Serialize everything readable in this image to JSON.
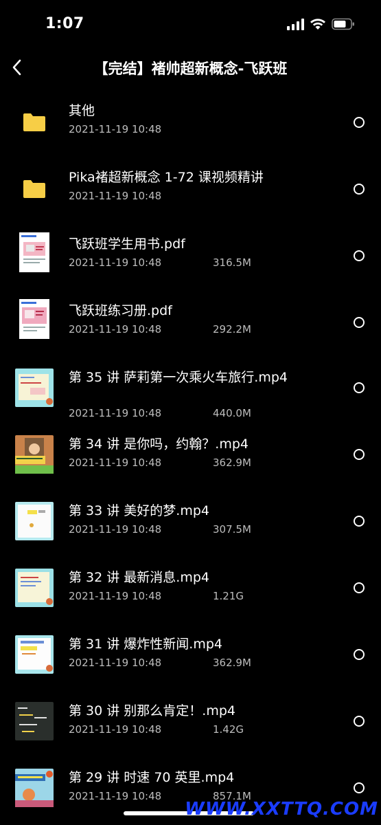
{
  "status_bar": {
    "time": "1:07"
  },
  "header": {
    "title": "【完结】褚帅超新概念-飞跃班",
    "back_icon": "chevron-left-icon"
  },
  "files": [
    {
      "name": "其他",
      "date": "2021-11-19 10:48",
      "size": "",
      "kind": "folder"
    },
    {
      "name": "Pika褚超新概念 1-72 课视频精讲",
      "date": "2021-11-19 10:48",
      "size": "",
      "kind": "folder"
    },
    {
      "name": "飞跃班学生用书.pdf",
      "date": "2021-11-19 10:48",
      "size": "316.5M",
      "kind": "pdf"
    },
    {
      "name": "飞跃班练习册.pdf",
      "date": "2021-11-19 10:48",
      "size": "292.2M",
      "kind": "pdf"
    },
    {
      "name": "第 35 讲 萨莉第一次乘火车旅行.mp4",
      "date": "2021-11-19 10:48",
      "size": "440.0M",
      "kind": "video"
    },
    {
      "name": "第 34 讲 是你吗，约翰？.mp4",
      "date": "2021-11-19 10:48",
      "size": "362.9M",
      "kind": "video"
    },
    {
      "name": "第 33 讲 美好的梦.mp4",
      "date": "2021-11-19 10:48",
      "size": "307.5M",
      "kind": "video"
    },
    {
      "name": "第 32 讲 最新消息.mp4",
      "date": "2021-11-19 10:48",
      "size": "1.21G",
      "kind": "video"
    },
    {
      "name": "第 31 讲 爆炸性新闻.mp4",
      "date": "2021-11-19 10:48",
      "size": "362.9M",
      "kind": "video"
    },
    {
      "name": "第 30 讲 别那么肯定！.mp4",
      "date": "2021-11-19 10:48",
      "size": "1.42G",
      "kind": "video"
    },
    {
      "name": "第 29 讲 时速 70 英里.mp4",
      "date": "2021-11-19 10:48",
      "size": "857.1M",
      "kind": "video"
    }
  ],
  "watermark": "WWW.XXTTQ.COM",
  "colors": {
    "background": "#000000",
    "folder": "#F7CE46",
    "meta_text": "#BDBDBD",
    "watermark": "#1A3CFF"
  }
}
